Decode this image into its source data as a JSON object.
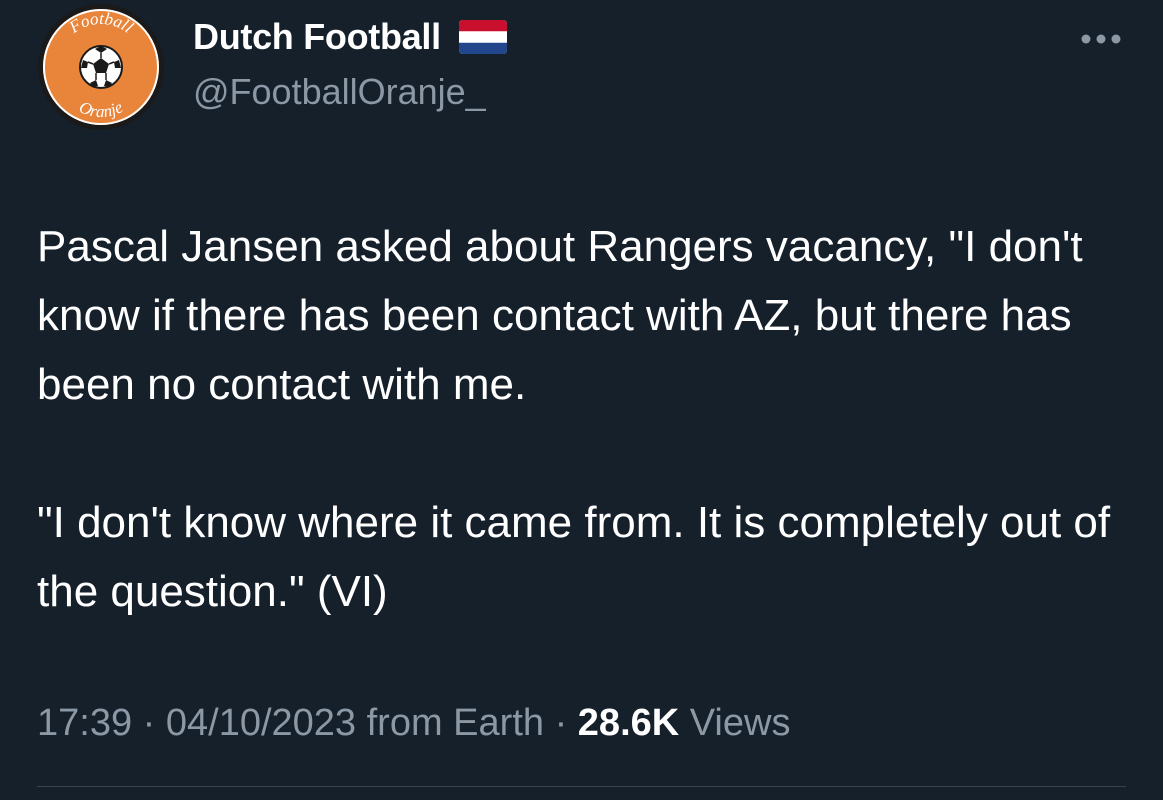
{
  "author": {
    "display_name": "Dutch Football",
    "handle": "@FootballOranje_",
    "flag_icon": "netherlands-flag-icon",
    "avatar": {
      "icon": "football-oranje-logo",
      "ring_text_top": "Football",
      "ring_text_bottom": "Oranje",
      "colors": {
        "ring": "#e8853a",
        "inner": "#ffffff",
        "outline": "#1a1a1a"
      }
    }
  },
  "more_icon": "more-options-icon",
  "tweet": {
    "paragraphs": [
      "Pascal Jansen asked about Rangers vacancy, \"I don't know if there has been contact with AZ, but there has been no contact with me.",
      "\"I don't know where it came from. It is completely out of the question.\" (VI)"
    ]
  },
  "meta": {
    "time": "17:39",
    "separator": "·",
    "date": "04/10/2023",
    "source": "from Earth",
    "views_count": "28.6K",
    "views_label": "Views"
  },
  "colors": {
    "background": "#15202b",
    "primary_text": "#ffffff",
    "secondary_text": "#8b98a5",
    "divider": "#38444d"
  }
}
